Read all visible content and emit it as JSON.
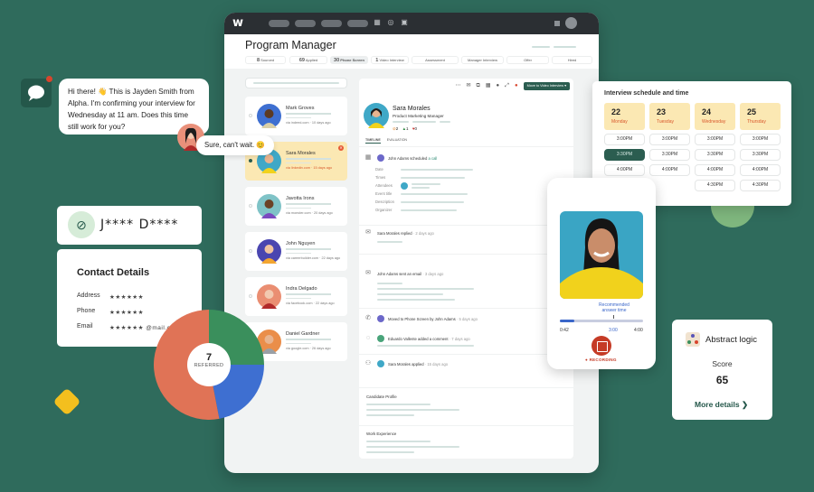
{
  "app": {
    "logo": "w",
    "page_title": "Program Manager",
    "stages": [
      {
        "count": "8",
        "label": "Sourced"
      },
      {
        "count": "69",
        "label": "Applied"
      },
      {
        "count": "30",
        "label": "Phone Screen",
        "active": true
      },
      {
        "count": "1",
        "label": "Video Interview"
      },
      {
        "count": "",
        "label": "Assessment"
      },
      {
        "count": "",
        "label": "Manager Interview"
      },
      {
        "count": "",
        "label": "Offer"
      },
      {
        "count": "",
        "label": "Hired"
      }
    ]
  },
  "candidates": [
    {
      "name": "Mark Groves",
      "source": "via indeed.com",
      "ago": "10 days ago"
    },
    {
      "name": "Sara Morales",
      "source": "via linkedin.com",
      "ago": "15 days ago",
      "selected": true
    },
    {
      "name": "Javotta Irons",
      "source": "via monster.com",
      "ago": "20 days ago"
    },
    {
      "name": "John Nguyen",
      "source": "via careerbuilder.com",
      "ago": "22 days ago"
    },
    {
      "name": "Indra Delgado",
      "source": "via facebook.com",
      "ago": "22 days ago"
    },
    {
      "name": "Daniel Gardner",
      "source": "via google.com",
      "ago": "26 days ago"
    }
  ],
  "detail": {
    "move_button": "Move to Video Interview",
    "name": "Sara Morales",
    "role": "Product Marketing Manager",
    "stats": {
      "pending": "2",
      "likes": "1",
      "dislikes": "0"
    },
    "tabs": [
      "TIMELINE",
      "EVALUATION"
    ],
    "timeline": {
      "call": {
        "actor": "John Adams",
        "action": "scheduled",
        "link": "a call"
      },
      "fields": [
        "Date",
        "Times",
        "Attendees",
        "Event title",
        "Description",
        "Organizer"
      ],
      "replied": {
        "text": "Sara Morales replied",
        "ago": "2 days ago"
      },
      "email": {
        "text": "John Adams sent an email",
        "ago": "3 days ago"
      },
      "moved": {
        "text": "Moved to Phone Screen by John Adams",
        "ago": "5 days ago"
      },
      "comment": {
        "text": "Eduardo Vallente added a comment",
        "ago": "7 days ago"
      },
      "applied": {
        "text": "Sara Morales applied",
        "ago": "15 days ago"
      }
    },
    "sections": [
      "Candidate Profile",
      "Work Experience"
    ]
  },
  "chat": {
    "message": "Hi there! 👋 This is Jayden Smith from Alpha. I'm confirming your interview for Wednesday at 11 am. Does this time still work for you?",
    "reply": "Sure, can't wait. 😊"
  },
  "hidden_card": {
    "name": "J**** D****"
  },
  "contact": {
    "title": "Contact Details",
    "rows": [
      {
        "label": "Address",
        "value": "★★★★★★"
      },
      {
        "label": "Phone",
        "value": "★★★★★★"
      },
      {
        "label": "Email",
        "value": "★★★★★★ @mail.com"
      }
    ]
  },
  "referred": {
    "count": "7",
    "label": "REFERRED",
    "segments": [
      {
        "color": "#3a8f5c",
        "share": 0.25
      },
      {
        "color": "#3e6fd1",
        "share": 0.22
      },
      {
        "color": "#e07356",
        "share": 0.53
      }
    ]
  },
  "schedule": {
    "title": "Interview schedule and time",
    "days": [
      {
        "num": "22",
        "name": "Monday",
        "slots": [
          "3:00PM",
          "3:30PM",
          "4:00PM"
        ],
        "selected": "3:30PM"
      },
      {
        "num": "23",
        "name": "Tuesday",
        "slots": [
          "3:00PM",
          "3:30PM",
          "4:00PM"
        ]
      },
      {
        "num": "24",
        "name": "Wednesday",
        "slots": [
          "3:00PM",
          "3:30PM",
          "4:00PM",
          "4:30PM"
        ]
      },
      {
        "num": "25",
        "name": "Thursday",
        "slots": [
          "3:00PM",
          "3:30PM",
          "4:00PM",
          "4:30PM"
        ]
      }
    ]
  },
  "recording": {
    "recommended_label": "Recommended answer time",
    "elapsed": "0:42",
    "recommended": "3:00",
    "max": "4:00",
    "progress_fraction": 0.175,
    "status": "RECORDING"
  },
  "assessment": {
    "title": "Abstract logic",
    "score_label": "Score",
    "score": "65",
    "more": "More details ❯"
  }
}
